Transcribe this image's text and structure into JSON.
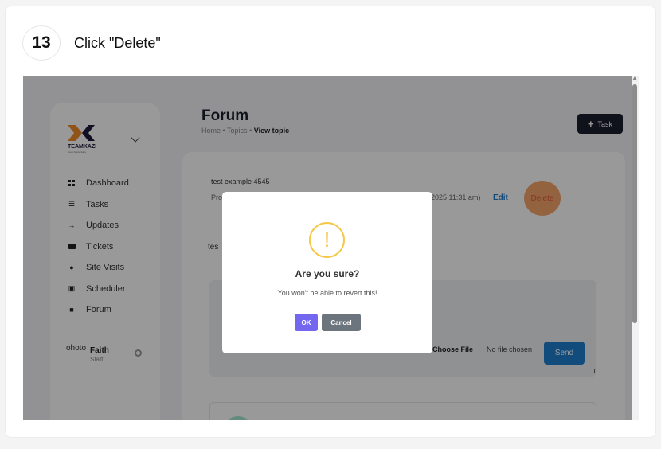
{
  "step": {
    "number": "13",
    "instruction": "Click \"Delete\""
  },
  "app": {
    "logo_text": "TEAMKAZI",
    "logo_sub": "Team Made Easy",
    "nav": [
      {
        "label": "Dashboard",
        "icon": "grid-icon"
      },
      {
        "label": "Tasks",
        "icon": "list-icon"
      },
      {
        "label": "Updates",
        "icon": "arrow-icon"
      },
      {
        "label": "Tickets",
        "icon": "ticket-icon"
      },
      {
        "label": "Site Visits",
        "icon": "location-pin-icon"
      },
      {
        "label": "Scheduler",
        "icon": "calendar-icon"
      },
      {
        "label": "Forum",
        "icon": "chat-icon"
      }
    ],
    "user": {
      "avatar_alt": "ohoto",
      "name": "Faith",
      "role": "Staff"
    }
  },
  "page": {
    "title": "Forum",
    "breadcrumb": {
      "home": "Home",
      "sep": "•",
      "topics": "Topics",
      "current": "View topic"
    },
    "task_button": "Task"
  },
  "topic": {
    "title": "test example 4545",
    "meta_prefix": "Pro",
    "meta_date": "2025 11:31 am)",
    "edit_label": "Edit",
    "delete_label": "Delete",
    "body_prefix": "tes"
  },
  "reply": {
    "choose_file": "Choose File",
    "no_file": "No file chosen",
    "send": "Send"
  },
  "modal": {
    "icon_glyph": "!",
    "title": "Are you sure?",
    "text": "You won't be able to revert this!",
    "ok": "OK",
    "cancel": "Cancel"
  },
  "colors": {
    "accent": "#7367f0",
    "warning": "#f5c847",
    "send": "#1f7fd1",
    "delete_highlight": "#f5a46a"
  }
}
